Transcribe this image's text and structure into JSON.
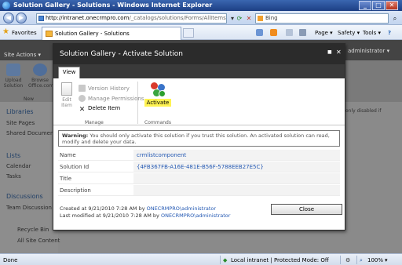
{
  "window": {
    "title": "Solution Gallery - Solutions - Windows Internet Explorer",
    "minimize": "_",
    "maximize": "□",
    "close": "✕"
  },
  "address_bar": {
    "url_domain": "http://intranet.onecrmpro.com",
    "url_path": "/_catalogs/solutions/Forms/AllItems.aspx",
    "search_value": "Bing",
    "back_icon": "◀",
    "forward_icon": "▶",
    "refresh_icon": "⟳",
    "stop_icon": "✕"
  },
  "favorites_bar": {
    "favorites_label": "Favorites",
    "tab_label": "Solution Gallery - Solutions",
    "page_menu": "Page ▾",
    "safety_menu": "Safety ▾",
    "tools_menu": "Tools ▾",
    "help_icon": "?"
  },
  "sharepoint": {
    "site_actions": "Site Actions ▾",
    "admin_label": "administrator ▾",
    "ribbon": {
      "upload_label": "Upload Solution",
      "browse_label": "Browse Office.com",
      "group_label": "New"
    },
    "left_nav": {
      "libraries": "Libraries",
      "site_pages": "Site Pages",
      "shared_documents": "Shared Documents",
      "lists": "Lists",
      "calendar": "Calendar",
      "tasks": "Tasks",
      "discussions": "Discussions",
      "team_discussion": "Team Discussion",
      "recycle_bin": "Recycle Bin",
      "all_site_content": "All Site Content"
    },
    "right_note": "only disabled if"
  },
  "dialog": {
    "title": "Solution Gallery - Activate Solution",
    "maximize_icon": "■",
    "close_icon": "✕",
    "tab_view": "View",
    "ribbon": {
      "edit_item": "Edit Item",
      "version_history": "Version History",
      "manage_permissions": "Manage Permissions",
      "delete_item": "Delete Item",
      "manage_group": "Manage",
      "activate": "Activate",
      "commands_group": "Commands"
    },
    "warning_label": "Warning:",
    "warning_text": "You should only activate this solution if you trust this solution. An activated solution can read, modify and delete your data.",
    "fields": [
      {
        "label": "Name",
        "value": "crmlistcomponent"
      },
      {
        "label": "Solution Id",
        "value": "{4FB367FB-A16E-481E-B56F-5788EEB27E5C}"
      },
      {
        "label": "Title",
        "value": ""
      },
      {
        "label": "Description",
        "value": ""
      }
    ],
    "created_prefix": "Created at 9/21/2010 7:28 AM  by",
    "created_by": "ONECRMPRO\\administrator",
    "modified_prefix": "Last modified at 9/21/2010 7:28 AM  by",
    "modified_by": "ONECRMPRO\\administrator",
    "close_button": "Close"
  },
  "status_bar": {
    "left": "Done",
    "zone": "Local intranet | Protected Mode: Off",
    "zoom": "100%"
  }
}
